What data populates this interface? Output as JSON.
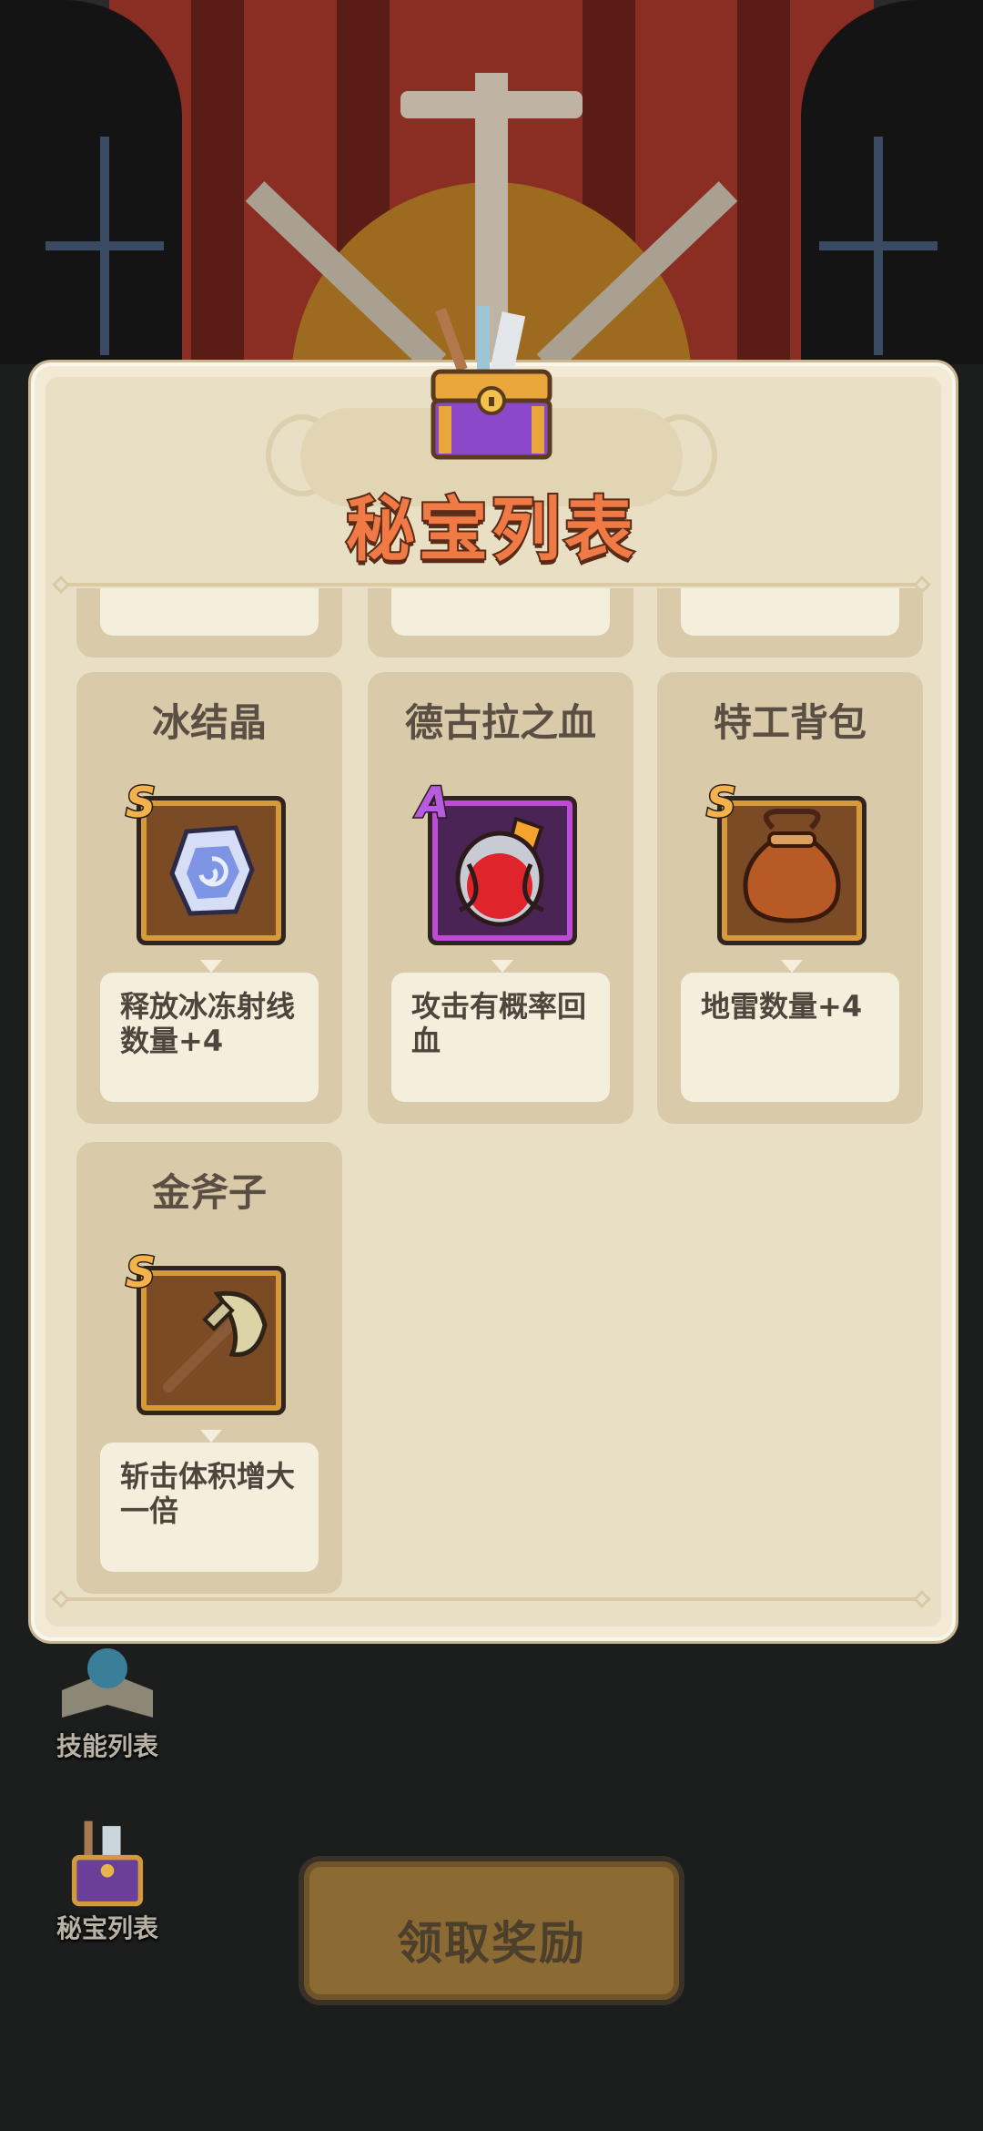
{
  "modal": {
    "title": "秘宝列表"
  },
  "items": [
    {
      "name": "冰结晶",
      "rank": "S",
      "description": "释放冰冻射线数量+4",
      "icon": "ice-crystal-icon"
    },
    {
      "name": "德古拉之血",
      "rank": "A",
      "description": "攻击有概率回血",
      "icon": "blood-potion-icon"
    },
    {
      "name": "特工背包",
      "rank": "S",
      "description": "地雷数量+4",
      "icon": "agent-bag-icon"
    },
    {
      "name": "金斧子",
      "rank": "S",
      "description": "斩击体积增大一倍",
      "icon": "golden-axe-icon"
    }
  ],
  "side_menu": {
    "skills_label": "技能列表",
    "treasures_label": "秘宝列表"
  },
  "claim_button": {
    "label": "领取奖励"
  },
  "colors": {
    "rank_s": "#f4b24a",
    "rank_a": "#b75ce0",
    "title": "#ef7a45",
    "claim_button": "#8c6a34"
  }
}
